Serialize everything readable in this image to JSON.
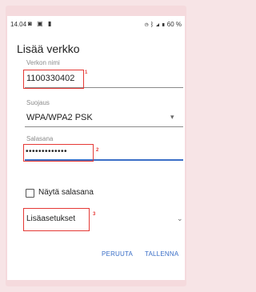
{
  "status_bar": {
    "time": "14.04",
    "left_icons": [
      "notification-icon",
      "image-icon",
      "sd-card-icon"
    ],
    "right_text": "60 %",
    "right_icons": [
      "alarm-icon",
      "bluetooth-icon",
      "signal-icon",
      "battery-icon"
    ]
  },
  "dialog": {
    "title": "Lisää verkko",
    "network_name": {
      "label": "Verkon nimi",
      "value": "1100330402",
      "marker": "1"
    },
    "security": {
      "label": "Suojaus",
      "value": "WPA/WPA2 PSK"
    },
    "password": {
      "label": "Salasana",
      "value": "•••••••••••••",
      "marker": "2"
    },
    "show_password": {
      "label": "Näytä salasana",
      "checked": false
    },
    "advanced": {
      "label": "Lisäasetukset",
      "marker": "3"
    },
    "buttons": {
      "cancel": "PERUUTA",
      "save": "TALLENNA"
    }
  },
  "colors": {
    "accent": "#3b6fc7",
    "highlight": "#e53935",
    "background": "#f7e4e6"
  }
}
